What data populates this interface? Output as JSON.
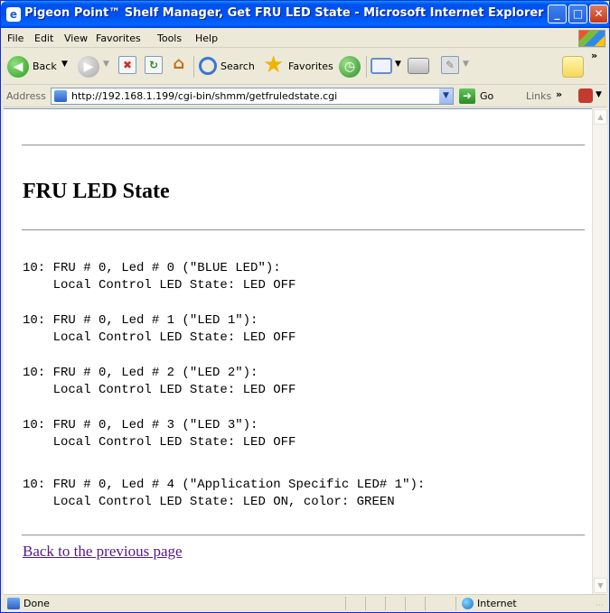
{
  "window": {
    "title": "Pigeon Point™ Shelf Manager, Get FRU LED State - Microsoft Internet Explorer",
    "controls": {
      "minimize": "_",
      "maximize": "□",
      "close": "✕"
    }
  },
  "menu": {
    "items": [
      "File",
      "Edit",
      "View",
      "Favorites",
      "Tools",
      "Help"
    ]
  },
  "toolbar": {
    "back_label": "Back",
    "search_label": "Search",
    "favorites_label": "Favorites"
  },
  "address": {
    "label": "Address",
    "url": "http://192.168.1.199/cgi-bin/shmm/getfruledstate.cgi",
    "go_label": "Go",
    "links_label": "Links",
    "links_chevron": "»"
  },
  "page": {
    "heading": "FRU LED State",
    "leds": [
      {
        "line1": "10: FRU # 0, Led # 0 (\"BLUE LED\"):",
        "line2": "    Local Control LED State: LED OFF"
      },
      {
        "line1": "10: FRU # 0, Led # 1 (\"LED 1\"):",
        "line2": "    Local Control LED State: LED OFF"
      },
      {
        "line1": "10: FRU # 0, Led # 2 (\"LED 2\"):",
        "line2": "    Local Control LED State: LED OFF"
      },
      {
        "line1": "10: FRU # 0, Led # 3 (\"LED 3\"):",
        "line2": "    Local Control LED State: LED OFF"
      },
      {
        "line1": "10: FRU # 0, Led # 4 (\"Application Specific LED# 1\"):",
        "line2": "    Local Control LED State: LED ON, color: GREEN"
      }
    ],
    "back_link": "Back to the previous page"
  },
  "status": {
    "text": "Done",
    "zone": "Internet"
  },
  "colors": {
    "titlebar": "#0053ee",
    "link_visited": "#551a8b",
    "chrome": "#ece9d8"
  },
  "icons": [
    "ie-page-icon",
    "back-arrow-icon",
    "forward-arrow-icon",
    "stop-icon",
    "refresh-icon",
    "home-icon",
    "search-icon",
    "favorites-star-icon",
    "history-icon",
    "mail-icon",
    "print-icon",
    "edit-icon",
    "discuss-icon",
    "windows-logo-icon",
    "go-arrow-icon",
    "globe-icon"
  ]
}
